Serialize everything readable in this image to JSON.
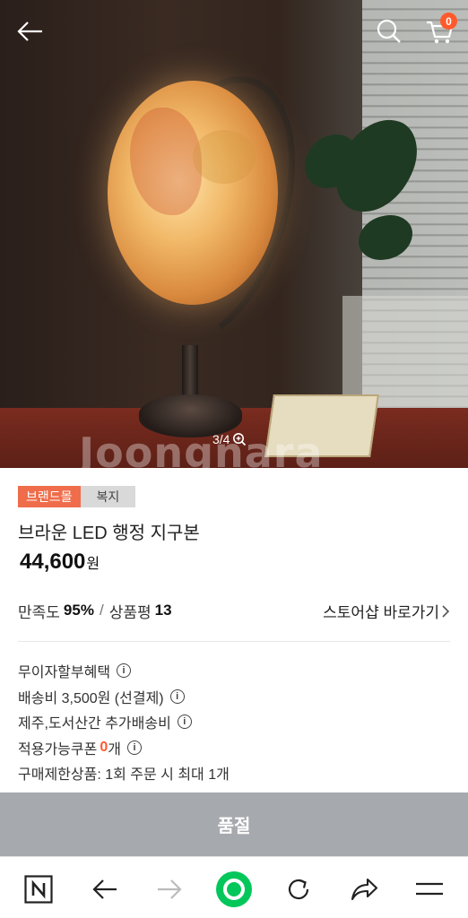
{
  "hero": {
    "watermark": "Joongnara",
    "counter": "3/4",
    "cart_count": "0"
  },
  "product": {
    "tags": {
      "brand": "브랜드몰",
      "category": "복지"
    },
    "title": "브라운 LED 행정 지구본",
    "price": "44,600",
    "price_unit": "원"
  },
  "rating": {
    "satisfaction_label": "만족도",
    "satisfaction_value": "95%",
    "separator": "/",
    "review_label": "상품평",
    "review_count": "13",
    "store_link": "스토어샵 바로가기"
  },
  "info": {
    "installment": "무이자할부혜택",
    "shipping": "배송비 3,500원 (선결제)",
    "extra_shipping": "제주,도서산간 추가배송비",
    "coupon_label": "적용가능쿠폰",
    "coupon_count": "0",
    "coupon_unit": "개",
    "purchase_limit": "구매제한상품: 1회 주문 시 최대 1개"
  },
  "cta": {
    "label": "품절"
  },
  "colors": {
    "accent": "#ef6d4a",
    "badge": "#ff5a2c",
    "soldout_bg": "#a6a9ae",
    "naver_green": "#03c75a"
  },
  "navbar": {
    "items": [
      "naver-home-icon",
      "back-arrow-icon",
      "forward-arrow-icon",
      "green-dot-icon",
      "refresh-icon",
      "share-icon",
      "menu-icon"
    ]
  }
}
